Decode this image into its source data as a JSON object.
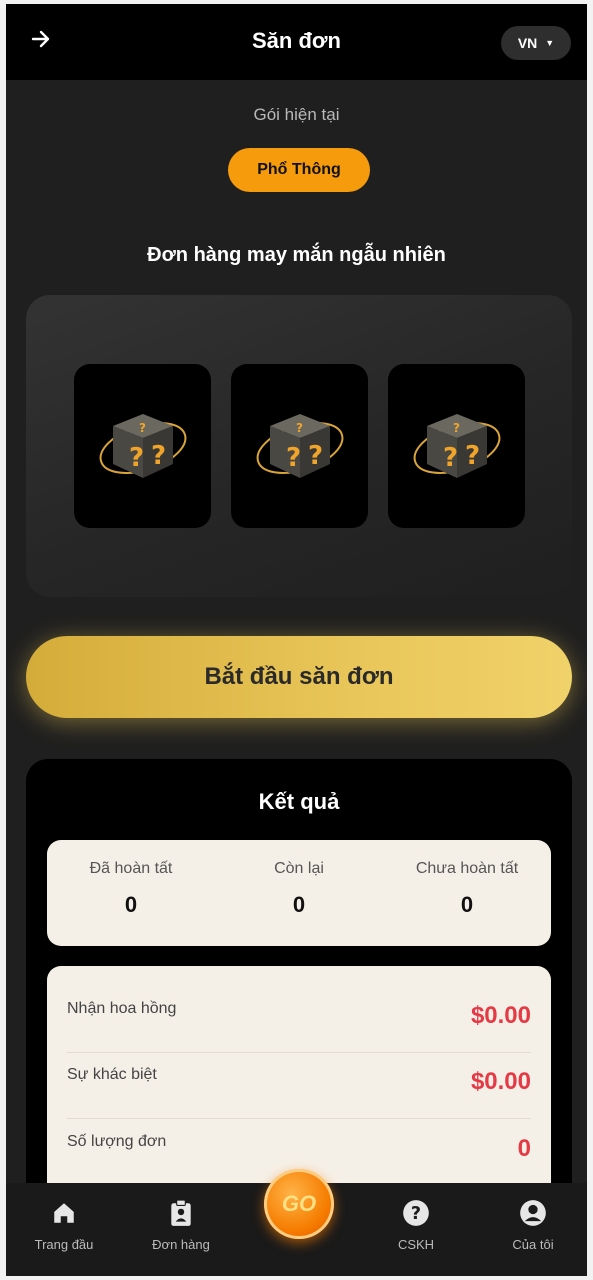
{
  "header": {
    "title": "Săn đơn",
    "lang": "VN"
  },
  "package": {
    "label": "Gói hiện tại",
    "current": "Phổ Thông"
  },
  "lucky": {
    "title": "Đơn hàng may mắn ngẫu nhiên",
    "boxes": [
      "mystery-box",
      "mystery-box",
      "mystery-box"
    ]
  },
  "actions": {
    "start_label": "Bắt đầu săn đơn"
  },
  "results": {
    "title": "Kết quả",
    "stats": [
      {
        "label": "Đã hoàn tất",
        "value": "0"
      },
      {
        "label": "Còn lại",
        "value": "0"
      },
      {
        "label": "Chưa hoàn tất",
        "value": "0"
      }
    ],
    "rows": [
      {
        "label": "Nhận hoa hồng",
        "value": "$0.00"
      },
      {
        "label": "Sự khác biệt",
        "value": "$0.00"
      },
      {
        "label": "Số lượng đơn",
        "value": "0"
      }
    ]
  },
  "nav": {
    "items": [
      {
        "label": "Trang đầu",
        "icon": "home-icon"
      },
      {
        "label": "Đơn hàng",
        "icon": "orders-icon"
      },
      {
        "label": "CSKH",
        "icon": "help-icon"
      },
      {
        "label": "Của tôi",
        "icon": "user-icon"
      }
    ],
    "go_label": "GO"
  },
  "colors": {
    "accent": "#f59b0c",
    "gold": "#e9c659",
    "negative": "#e63946",
    "panel": "#f5f0e7"
  }
}
